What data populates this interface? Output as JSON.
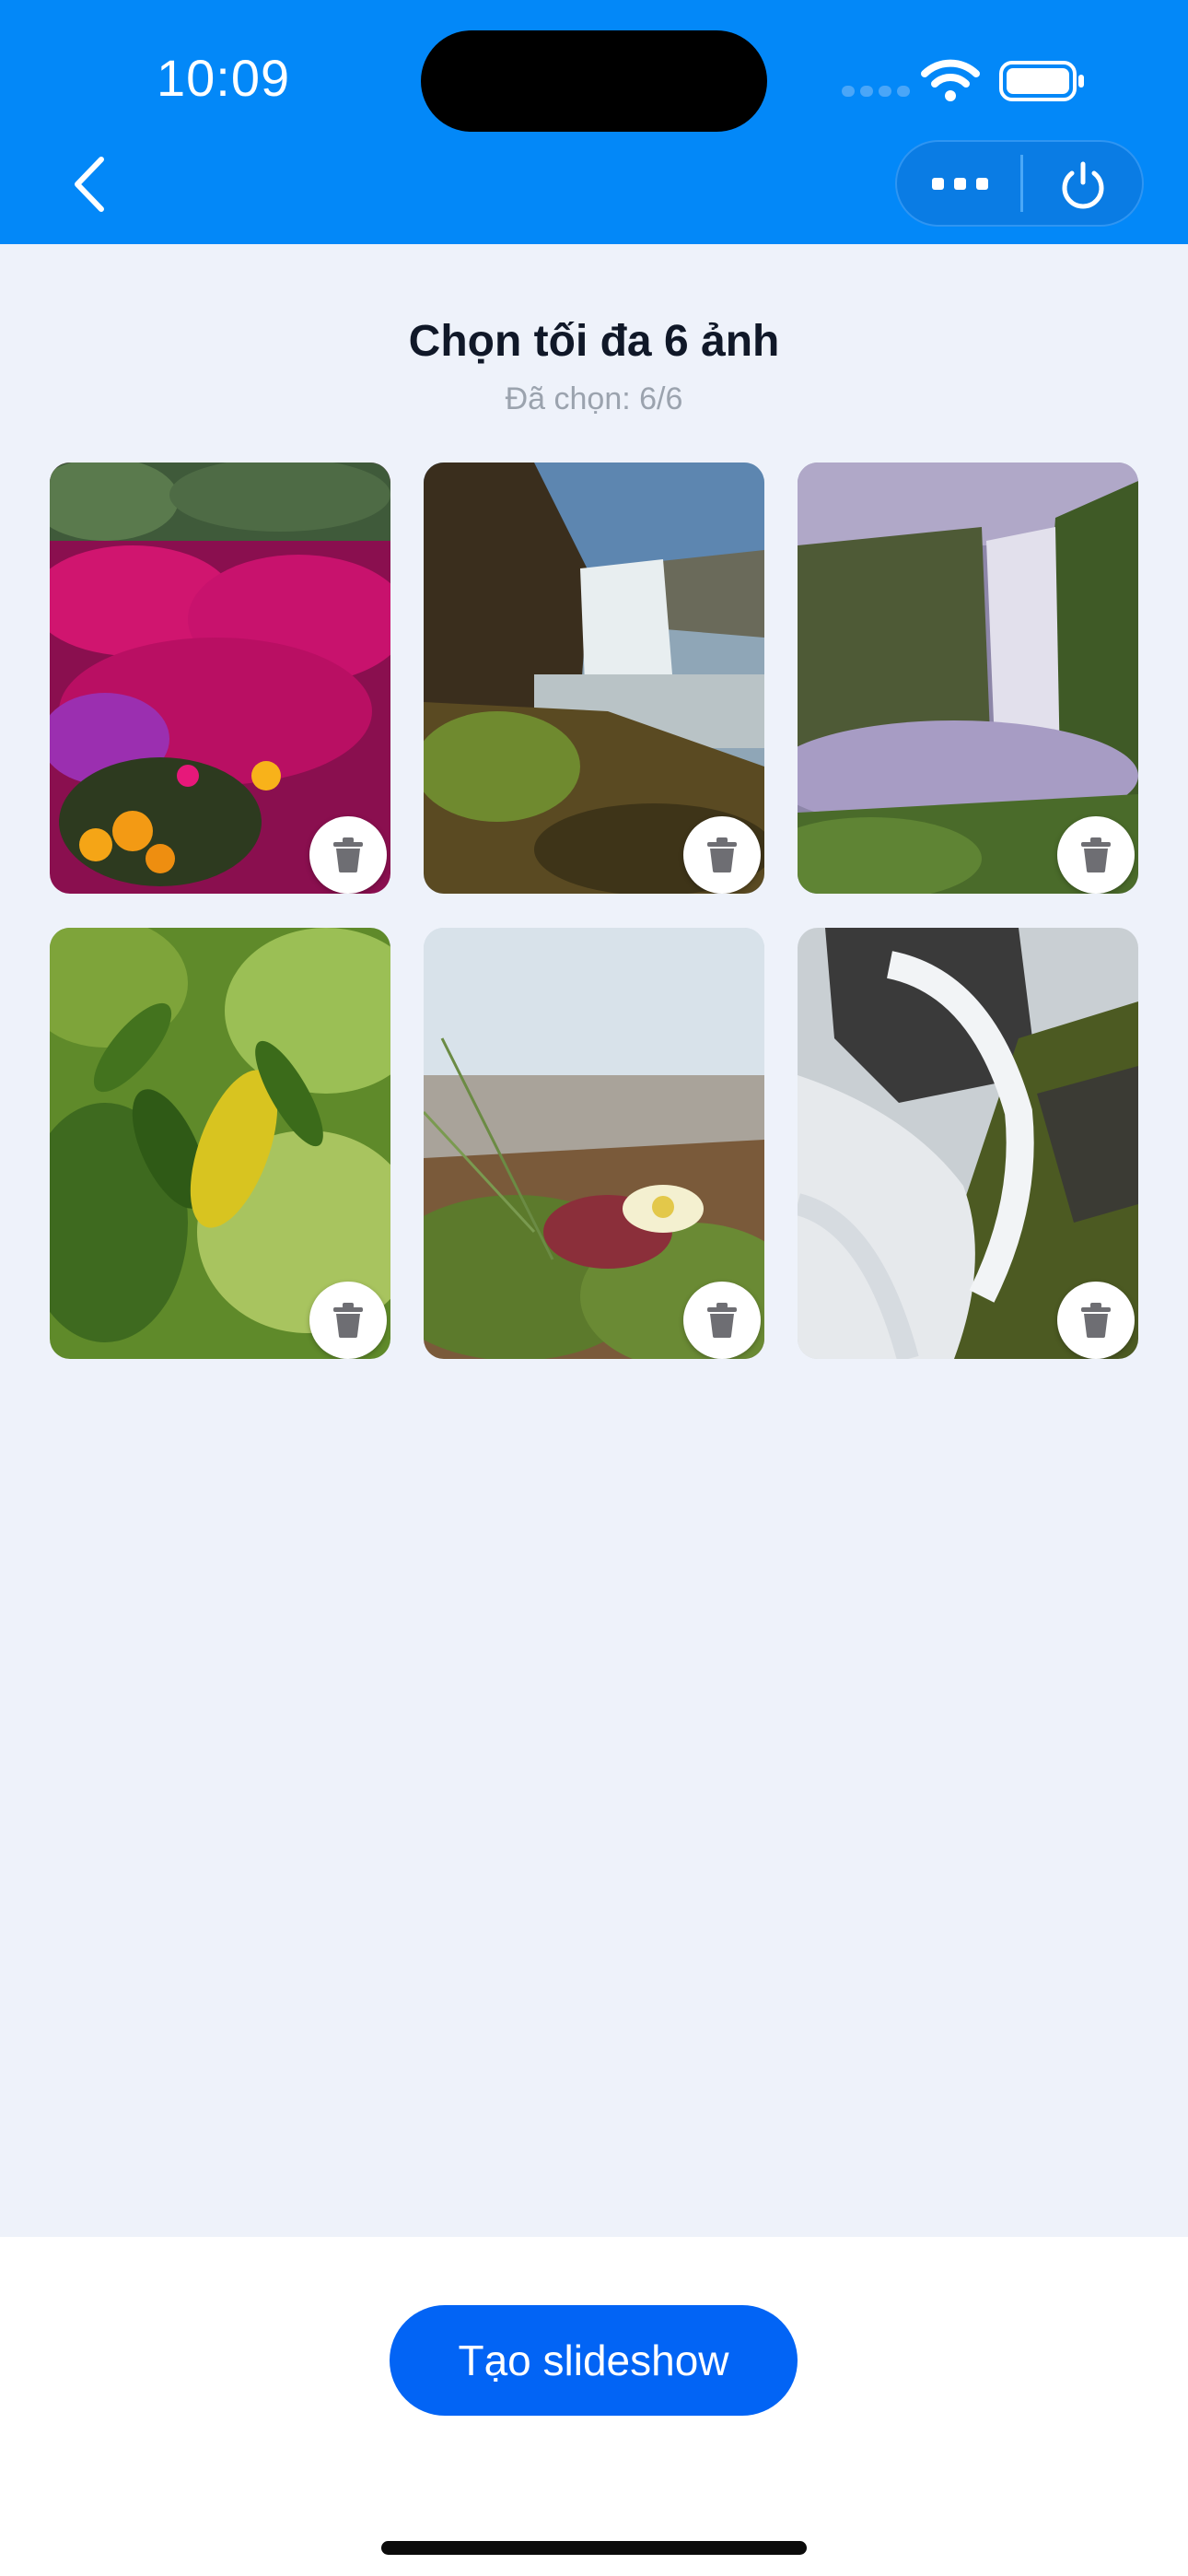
{
  "status_bar": {
    "time": "10:09"
  },
  "nav": {
    "back_icon": "chevron-left-icon",
    "more_icon": "more-icon",
    "power_icon": "power-icon",
    "accent": "#0388f8"
  },
  "header": {
    "title": "Chọn tối đa 6 ảnh",
    "subtitle": "Đã chọn: 6/6"
  },
  "photos": [
    {
      "subject": "pink flowers",
      "delete_icon": "trash-icon"
    },
    {
      "subject": "waterfall cliff",
      "delete_icon": "trash-icon"
    },
    {
      "subject": "misty waterfall",
      "delete_icon": "trash-icon"
    },
    {
      "subject": "green leaves",
      "delete_icon": "trash-icon"
    },
    {
      "subject": "white flower grass",
      "delete_icon": "trash-icon"
    },
    {
      "subject": "waterfall rocks",
      "delete_icon": "trash-icon"
    }
  ],
  "footer": {
    "create_button": "Tạo slideshow",
    "button_color": "#0264f5"
  }
}
